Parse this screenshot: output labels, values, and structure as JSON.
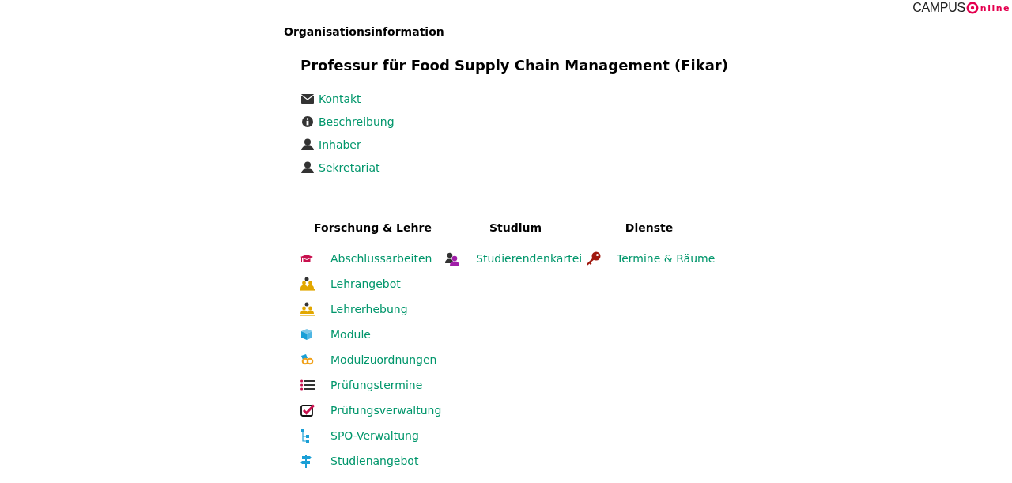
{
  "logo": {
    "text": "CAMPUS",
    "suffix": "nline"
  },
  "page_title": "Organisationsinformation",
  "org_name": "Professur für Food Supply Chain Management (Fikar)",
  "links": [
    {
      "label": "Kontakt",
      "kind": "envelope"
    },
    {
      "label": "Beschreibung",
      "kind": "info"
    },
    {
      "label": "Inhaber",
      "kind": "person"
    },
    {
      "label": "Sekretariat",
      "kind": "person"
    }
  ],
  "sections": [
    {
      "heading": "Forschung & Lehre",
      "items": [
        {
          "label": "Abschlussarbeiten",
          "kind": "cap"
        },
        {
          "label": "Lehrangebot",
          "kind": "group"
        },
        {
          "label": "Lehrerhebung",
          "kind": "group"
        },
        {
          "label": "Module",
          "kind": "cube"
        },
        {
          "label": "Modulzuordnungen",
          "kind": "chain"
        },
        {
          "label": "Prüfungstermine",
          "kind": "list"
        },
        {
          "label": "Prüfungsverwaltung",
          "kind": "check"
        },
        {
          "label": "SPO-Verwaltung",
          "kind": "tree"
        },
        {
          "label": "Studienangebot",
          "kind": "signpost"
        }
      ]
    },
    {
      "heading": "Studium",
      "items": [
        {
          "label": "Studierendenkartei",
          "kind": "students"
        }
      ]
    },
    {
      "heading": "Dienste",
      "items": [
        {
          "label": "Termine & Räume",
          "kind": "key"
        }
      ]
    }
  ]
}
